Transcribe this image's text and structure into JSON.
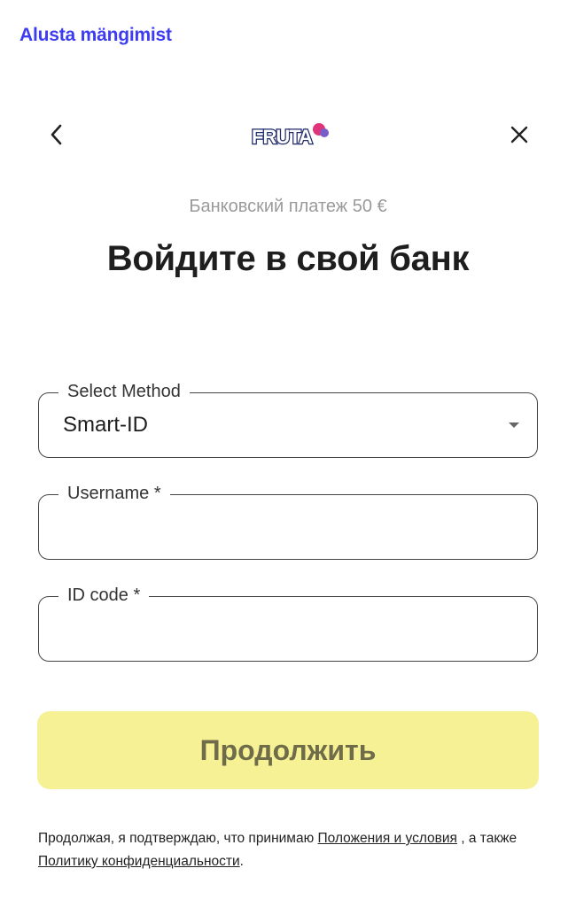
{
  "header": {
    "link_text": "Alusta mängimist"
  },
  "nav": {
    "back_icon": "chevron-left-icon",
    "close_icon": "close-icon",
    "logo_text": "FRUTA",
    "colors": {
      "logo_fill": "#ffffff",
      "logo_outline": "#1d2a6b",
      "logo_accent": "#e0347a"
    }
  },
  "payment": {
    "subtitle": "Банковский платеж 50 €",
    "title": "Войдите в свой банк"
  },
  "form": {
    "method": {
      "label": "Select Method",
      "value": "Smart-ID"
    },
    "username": {
      "label": "Username *",
      "value": ""
    },
    "id_code": {
      "label": "ID code *",
      "value": ""
    }
  },
  "continue_button": {
    "label": "Продолжить",
    "color": "#f7f196"
  },
  "legal": {
    "text_before": "Продолжая, я подтверждаю, что принимаю ",
    "terms_link": "Положения и условия",
    "text_middle": " , а также ",
    "privacy_link": "Политику конфиденциальности",
    "text_after": "."
  },
  "colors": {
    "link": "#3d3cf0",
    "border": "#444444"
  }
}
